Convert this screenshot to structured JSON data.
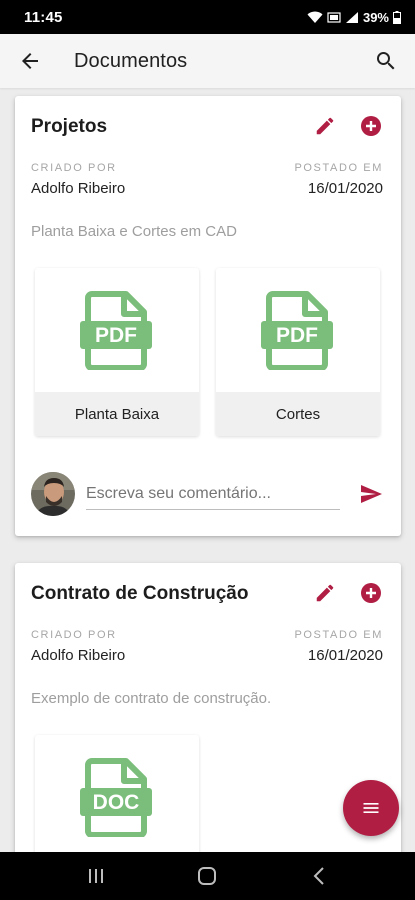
{
  "status_bar": {
    "time": "11:45",
    "battery": "39%"
  },
  "app_bar": {
    "title": "Documentos"
  },
  "colors": {
    "accent": "#b01e44",
    "file_icon": "#7bbd7b"
  },
  "cards": [
    {
      "title": "Projetos",
      "created_by_label": "CRIADO POR",
      "created_by": "Adolfo Ribeiro",
      "posted_label": "POSTADO EM",
      "posted_date": "16/01/2020",
      "description": "Planta Baixa e Cortes em CAD",
      "files": [
        {
          "type": "PDF",
          "name": "Planta Baixa"
        },
        {
          "type": "PDF",
          "name": "Cortes"
        }
      ],
      "comment_placeholder": "Escreva seu comentário..."
    },
    {
      "title": "Contrato de Construção",
      "created_by_label": "CRIADO POR",
      "created_by": "Adolfo Ribeiro",
      "posted_label": "POSTADO EM",
      "posted_date": "16/01/2020",
      "description": "Exemplo de contrato de construção.",
      "files": [
        {
          "type": "DOC",
          "name": ""
        }
      ]
    }
  ],
  "icons": {
    "back": "arrow-back-icon",
    "search": "search-icon",
    "edit": "pencil-icon",
    "add": "add-circle-icon",
    "send": "send-icon",
    "menu": "menu-icon"
  }
}
